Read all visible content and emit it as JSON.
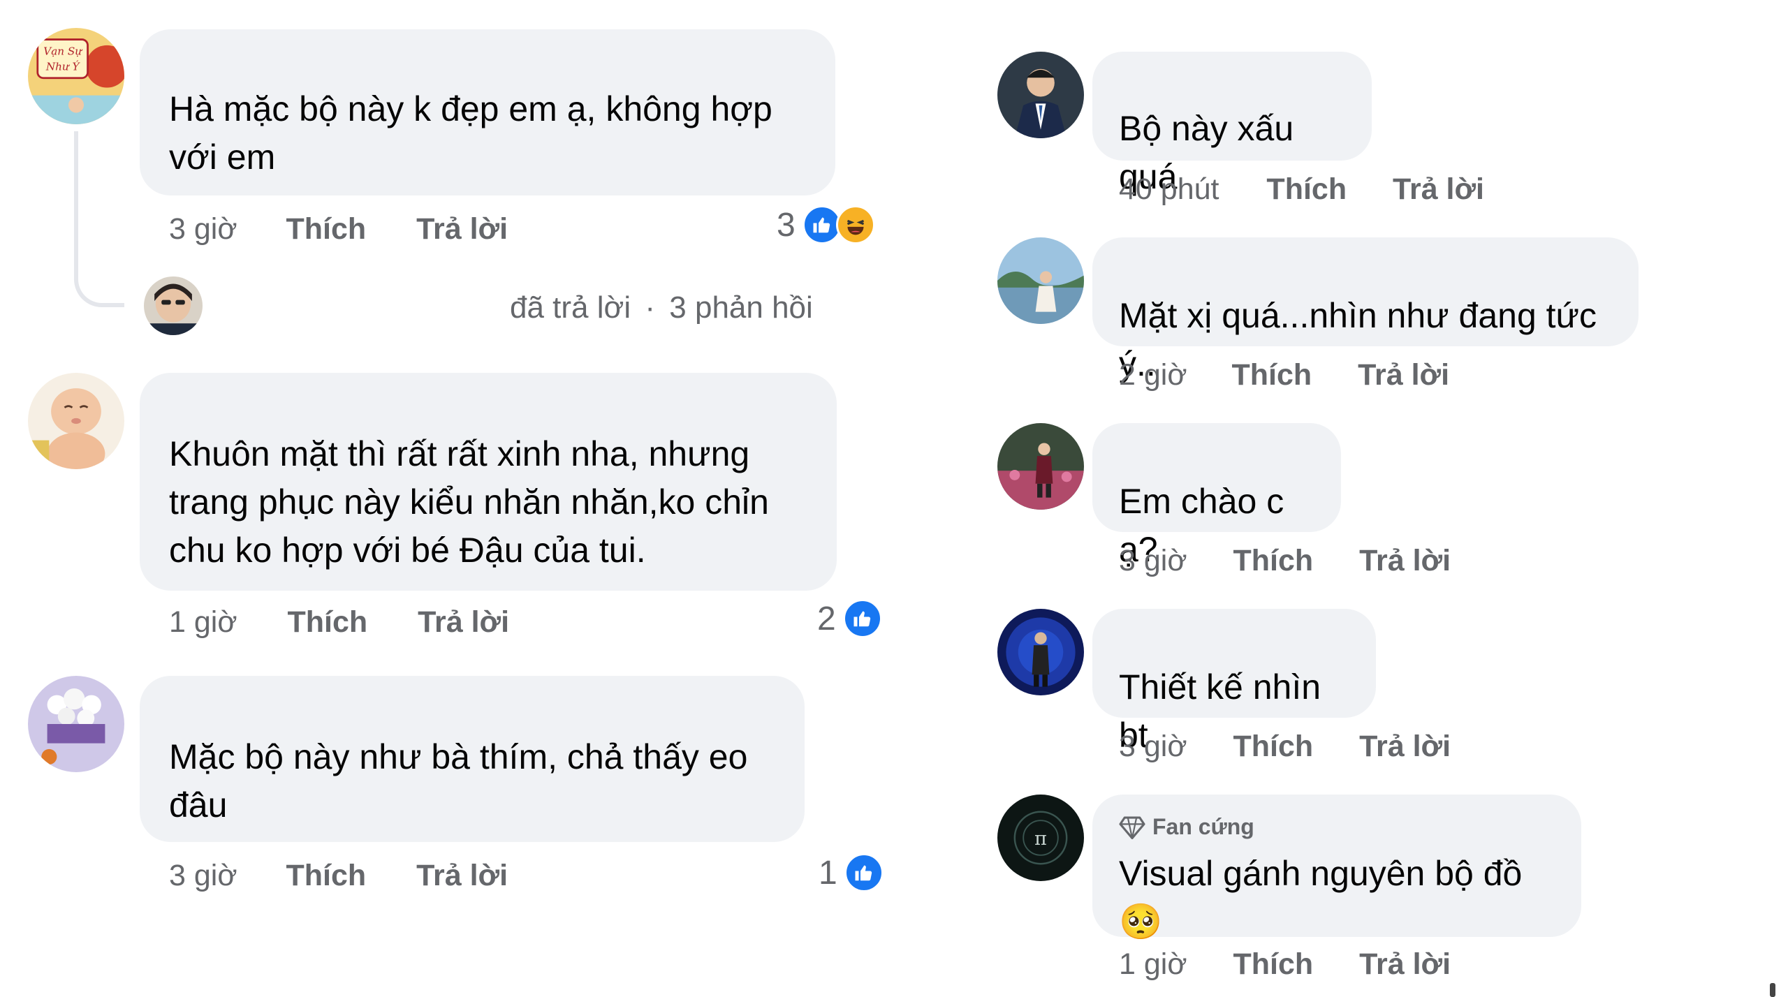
{
  "left_comments": [
    {
      "text": "Hà mặc bộ này k đẹp em ạ, không hợp\nvới em",
      "time": "3 giờ",
      "like_label": "Thích",
      "reply_label": "Trả lời",
      "reaction_count": "3",
      "reactions": [
        "like-icon",
        "haha-icon"
      ]
    },
    {
      "text": "Khuôn mặt thì rất rất xinh nha, nhưng\ntrang phục này kiểu nhăn nhăn,ko chỉn\nchu ko hợp với bé Đậu của tui.",
      "time": "1 giờ",
      "like_label": "Thích",
      "reply_label": "Trả lời",
      "reaction_count": "2",
      "reactions": [
        "like-icon"
      ]
    },
    {
      "text": "Mặc bộ này như bà thím, chả thấy eo\nđâu",
      "time": "3 giờ",
      "like_label": "Thích",
      "reply_label": "Trả lời",
      "reaction_count": "1",
      "reactions": [
        "like-icon"
      ]
    }
  ],
  "reply_summary": {
    "replied_text": "đã trả lời",
    "separator": "·",
    "replies_count_text": "3 phản hồi"
  },
  "right_comments": [
    {
      "text": "Bộ này xấu quá",
      "time": "40 phút",
      "like_label": "Thích",
      "reply_label": "Trả lời"
    },
    {
      "text": "Mặt xị quá...nhìn như đang tức ý..",
      "time": "2 giờ",
      "like_label": "Thích",
      "reply_label": "Trả lời"
    },
    {
      "text": "Em chào c ạ?",
      "time": "3 giờ",
      "like_label": "Thích",
      "reply_label": "Trả lời"
    },
    {
      "text": "Thiết kế nhìn bt",
      "time": "3 giờ",
      "like_label": "Thích",
      "reply_label": "Trả lời"
    },
    {
      "text": "Visual gánh nguyên bộ đồ 🥺",
      "time": "1 giờ",
      "like_label": "Thích",
      "reply_label": "Trả lời",
      "badge": "Fan cứng",
      "badge_icon": "diamond-icon"
    }
  ],
  "avatar_text": {
    "first": "Vạn Sự Như Ý"
  },
  "colors": {
    "bubble": "#f0f2f5",
    "meta": "#65676b",
    "like": "#1877f2",
    "haha": "#f7b125"
  }
}
